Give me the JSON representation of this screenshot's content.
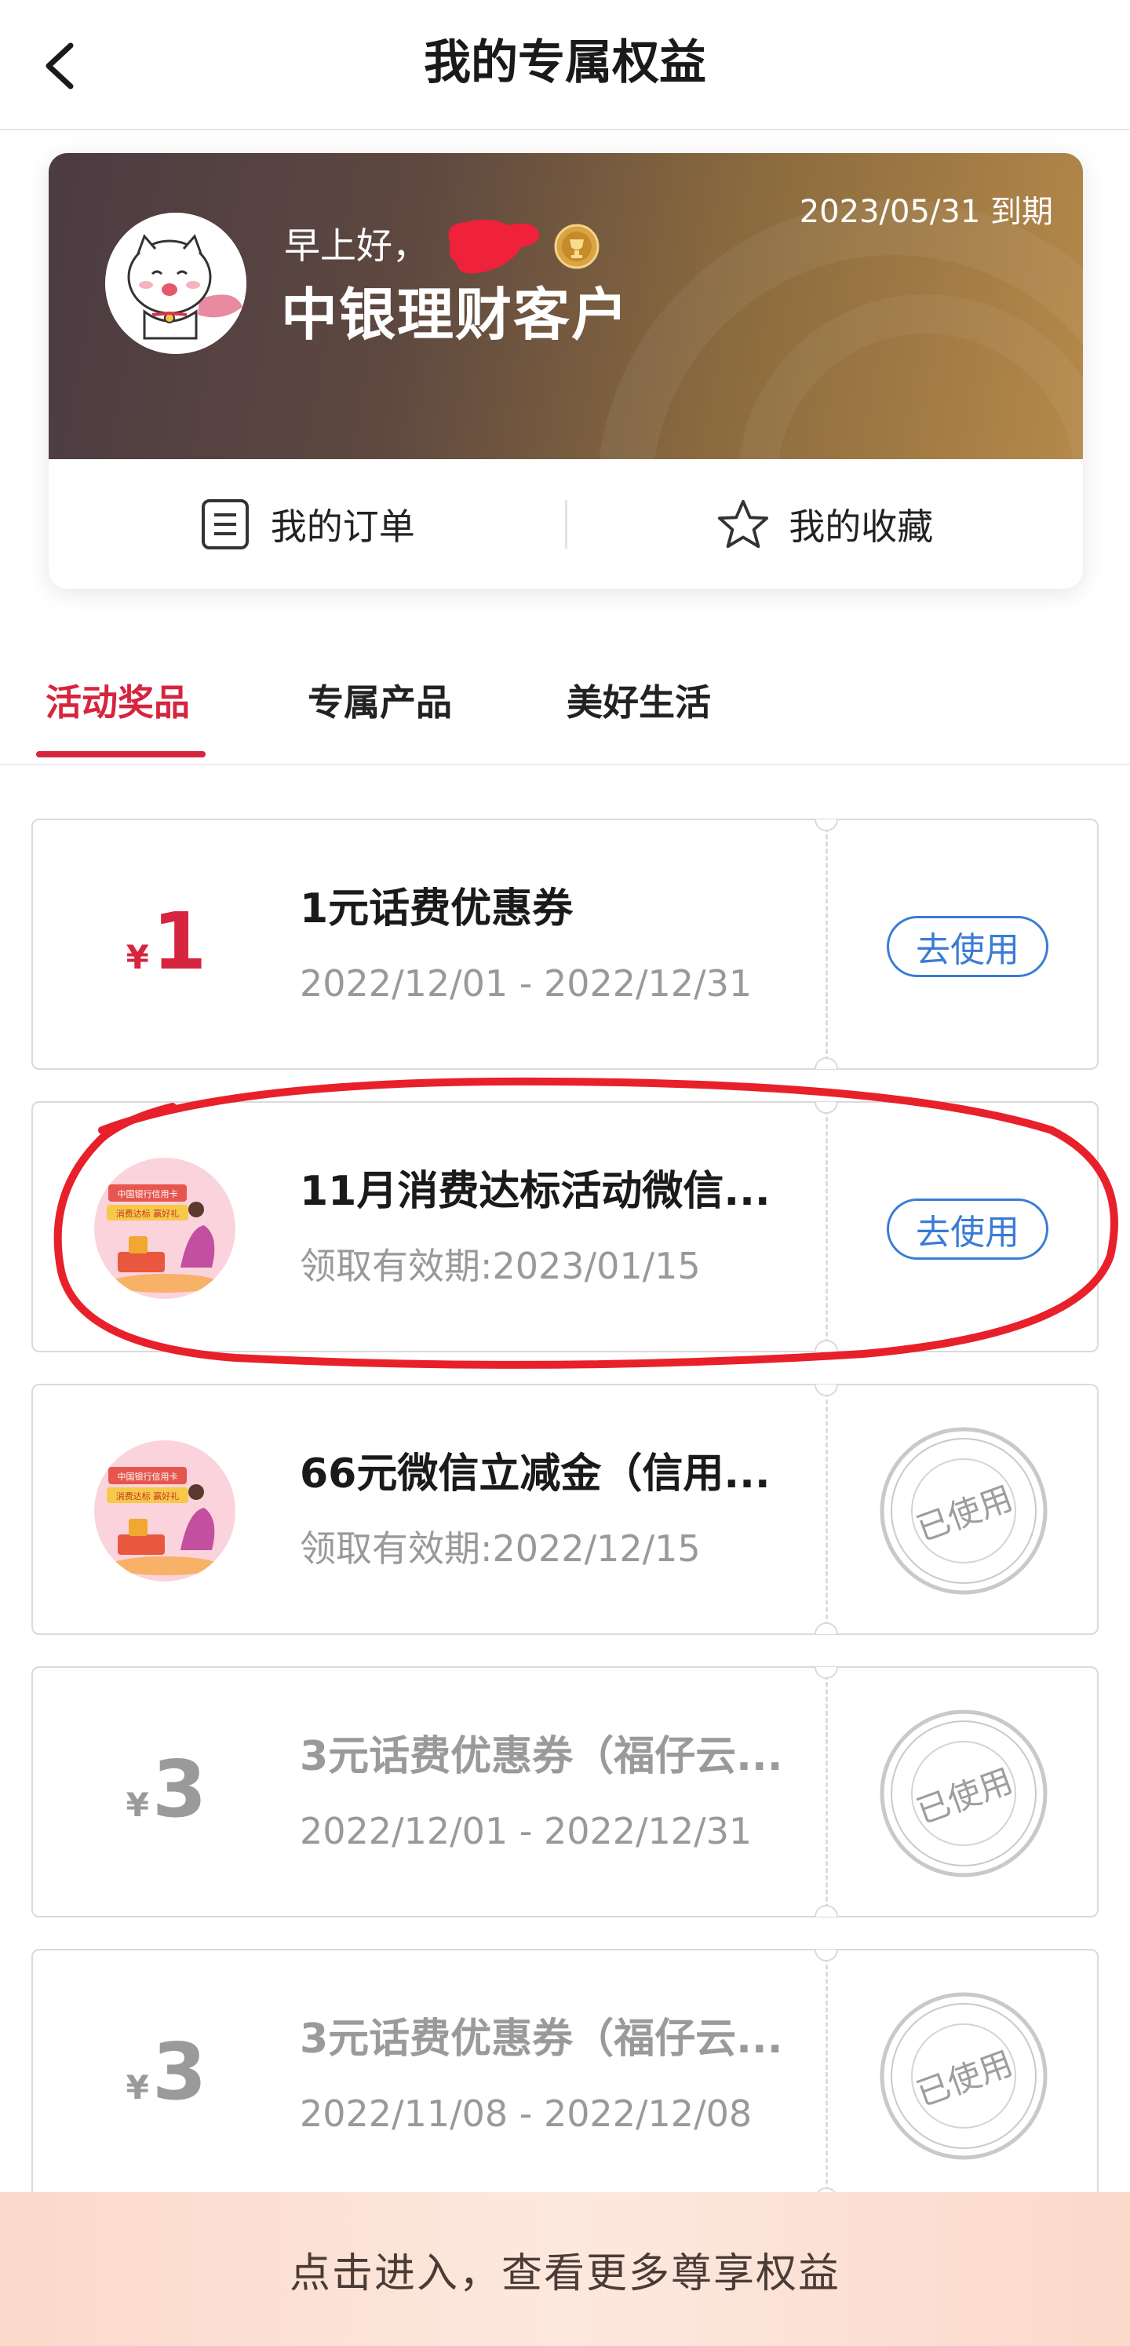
{
  "header": {
    "title": "我的专属权益",
    "back_icon": "chevron-left-icon"
  },
  "profile": {
    "expiry": "2023/05/31 到期",
    "greeting": "早上好，",
    "customer_level": "中银理财客户",
    "badge_icon": "medal-icon"
  },
  "actions": {
    "orders_label": "我的订单",
    "favorites_label": "我的收藏"
  },
  "tabs": [
    {
      "label": "活动奖品",
      "active": true
    },
    {
      "label": "专属产品",
      "active": false
    },
    {
      "label": "美好生活",
      "active": false
    }
  ],
  "coupons": [
    {
      "yen": "¥",
      "amount": "1",
      "title": "1元话费优惠券",
      "subtitle": "2022/12/01 - 2022/12/31",
      "status": "去使用"
    },
    {
      "title": "11月消费达标活动微信...",
      "subtitle": "领取有效期:2023/01/15",
      "status": "去使用",
      "image_text_line1": "中国银行信用卡",
      "image_text_line2": "消费达标 赢好礼"
    },
    {
      "title": "66元微信立减金（信用...",
      "subtitle": "领取有效期:2022/12/15",
      "status": "已使用",
      "image_text_line1": "中国银行信用卡",
      "image_text_line2": "消费达标 赢好礼"
    },
    {
      "yen": "¥",
      "amount": "3",
      "title": "3元话费优惠券（福仔云...",
      "subtitle": "2022/12/01 - 2022/12/31",
      "status": "已使用"
    },
    {
      "yen": "¥",
      "amount": "3",
      "title": "3元话费优惠券（福仔云...",
      "subtitle": "2022/11/08 - 2022/12/08",
      "status": "已使用"
    }
  ],
  "bottom_banner": {
    "label": "点击进入，查看更多尊享权益"
  },
  "colors": {
    "accent_red": "#d6253e",
    "link_blue": "#3a7bd5",
    "annotation_red": "#e8202a"
  }
}
